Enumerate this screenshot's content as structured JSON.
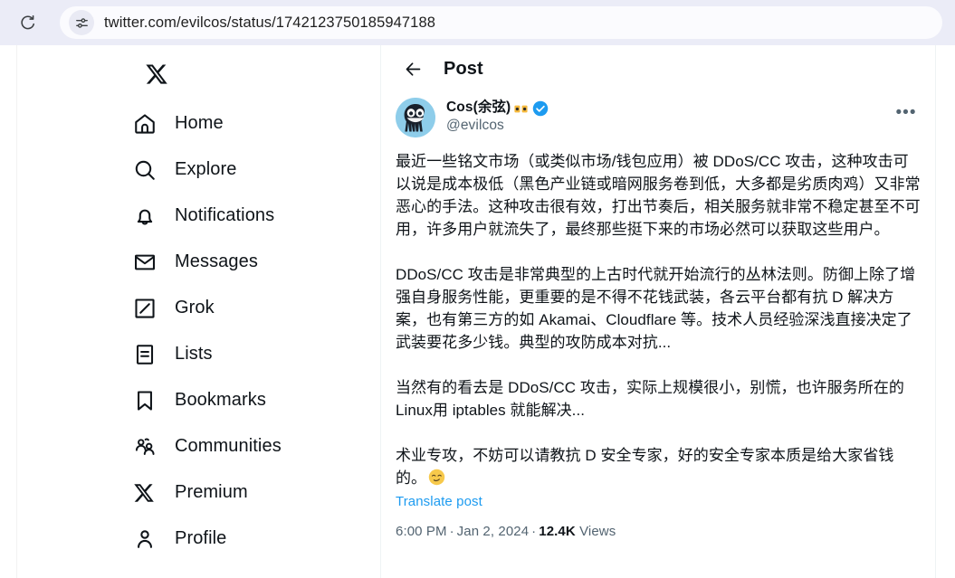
{
  "browser": {
    "reload_icon": "reload-icon",
    "site_settings_icon": "tune-sliders-icon",
    "url": "twitter.com/evilcos/status/1742123750185947188"
  },
  "sidebar": {
    "logo": "x-logo",
    "items": [
      {
        "label": "Home",
        "icon": "home-icon"
      },
      {
        "label": "Explore",
        "icon": "search-icon"
      },
      {
        "label": "Notifications",
        "icon": "bell-icon"
      },
      {
        "label": "Messages",
        "icon": "envelope-icon"
      },
      {
        "label": "Grok",
        "icon": "grok-slash-icon"
      },
      {
        "label": "Lists",
        "icon": "lists-icon"
      },
      {
        "label": "Bookmarks",
        "icon": "bookmark-icon"
      },
      {
        "label": "Communities",
        "icon": "communities-icon"
      },
      {
        "label": "Premium",
        "icon": "x-premium-icon"
      },
      {
        "label": "Profile",
        "icon": "person-icon"
      }
    ]
  },
  "post_header": {
    "back_icon": "back-arrow-icon",
    "title": "Post"
  },
  "post": {
    "author": {
      "avatar": "avatar-image",
      "display_name": "Cos(余弦)",
      "name_emoji": "eyes-emoji",
      "verified_icon": "verified-badge-icon",
      "handle": "@evilcos"
    },
    "more_menu_icon": "more-options-icon",
    "paragraphs": [
      "最近一些铭文市场（或类似市场/钱包应用）被 DDoS/CC 攻击，这种攻击可以说是成本极低（黑色产业链或暗网服务卷到低，大多都是劣质肉鸡）又非常恶心的手法。这种攻击很有效，打出节奏后，相关服务就非常不稳定甚至不可用，许多用户就流失了，最终那些挺下来的市场必然可以获取这些用户。",
      "",
      "DDoS/CC 攻击是非常典型的上古时代就开始流行的丛林法则。防御上除了增强自身服务性能，更重要的是不得不花钱武装，各云平台都有抗 D 解决方案，也有第三方的如 Akamai、Cloudflare 等。技术人员经验深浅直接决定了武装要花多少钱。典型的攻防成本对抗...",
      "",
      "当然有的看去是 DDoS/CC 攻击，实际上规模很小，别慌，也许服务所在的 Linux用 iptables 就能解决...",
      "",
      "术业专攻，不妨可以请教抗 D 安全专家，好的安全专家本质是给大家省钱的。"
    ],
    "tail_emoji": "relieved-face-emoji",
    "translate_label": "Translate post",
    "meta": {
      "time": "6:00 PM",
      "date": "Jan 2, 2024",
      "views_count": "12.4K",
      "views_label": "Views",
      "separator": "·"
    }
  },
  "colors": {
    "chrome_bg": "#ebecf7",
    "text_primary": "#0f1419",
    "text_secondary": "#536471",
    "link_blue": "#1d9bf0",
    "verified_blue": "#1d9bf0",
    "border": "#eff3f4",
    "avatar_bg": "#8ecdea"
  }
}
